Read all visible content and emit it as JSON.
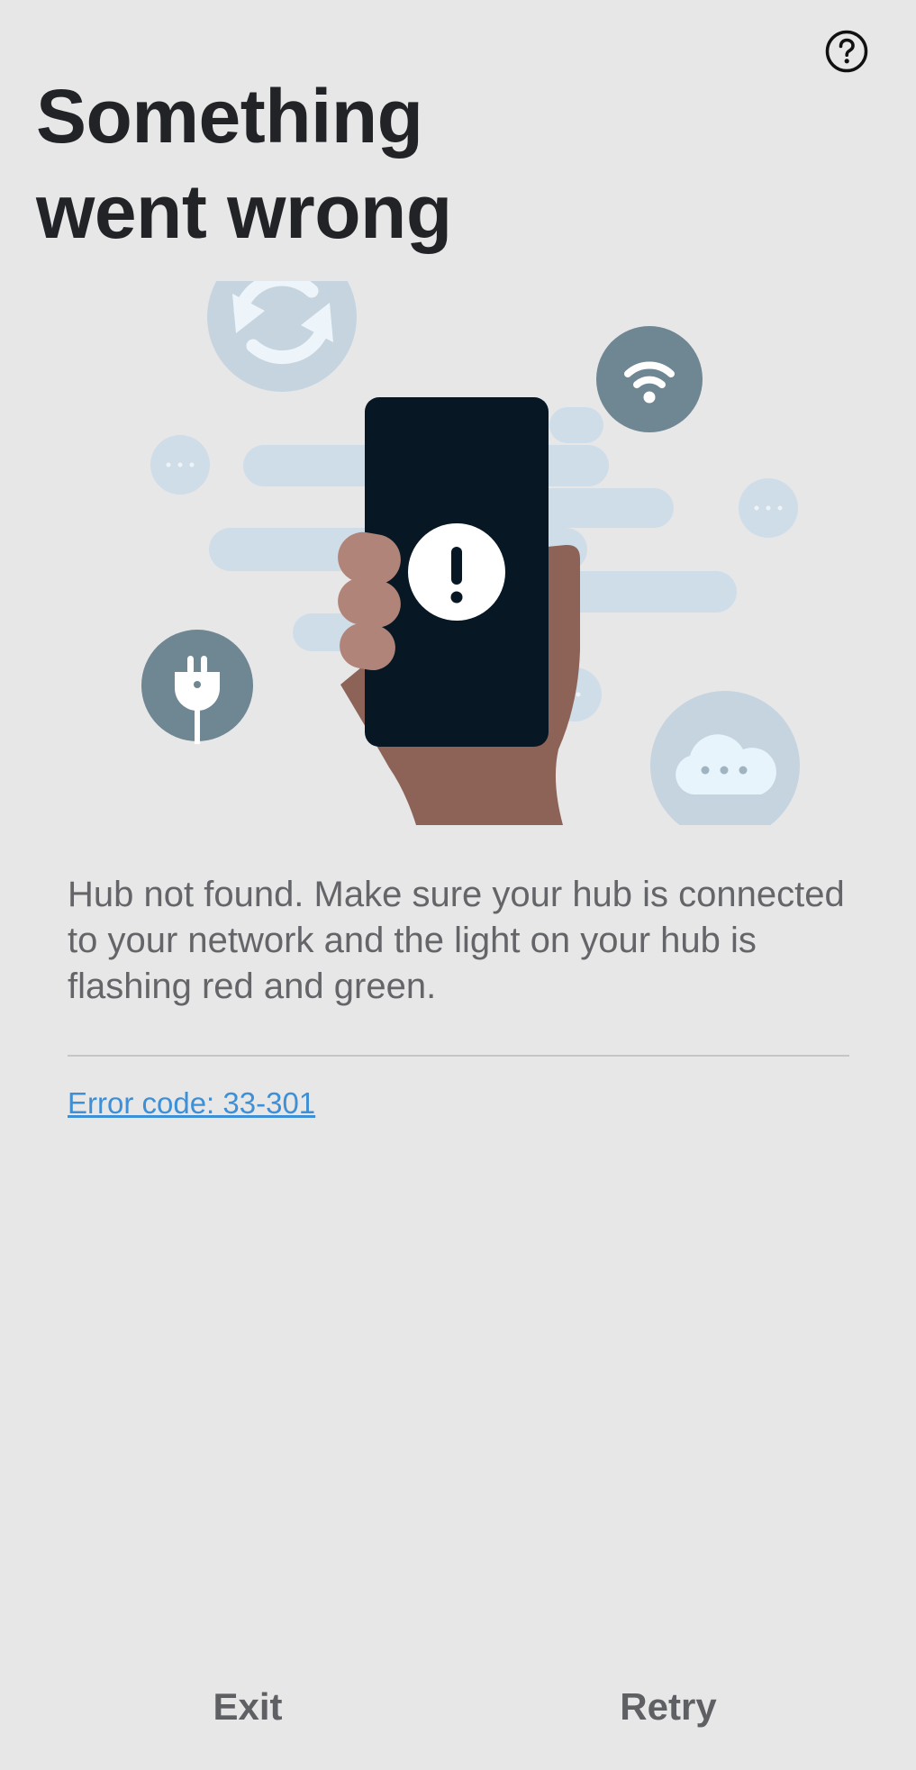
{
  "header": {
    "help_icon": "question-circle-icon",
    "title_line_1": "Something",
    "title_line_2": "went wrong"
  },
  "illustration": {
    "icons": [
      "sync-icon",
      "wifi-icon",
      "plug-icon",
      "cloud-icon",
      "alert-icon",
      "phone-icon",
      "hand-icon"
    ],
    "colors": {
      "phone": "#071824",
      "skin_dark": "#8d6358",
      "skin_light": "#b08478",
      "icon_circle_dark": "#6f8693",
      "icon_circle_light": "#c5d4df",
      "cloud_streaks": "#cfdde8"
    }
  },
  "content": {
    "message": "Hub not found. Make sure your hub is connected to your network and the light on your hub is flashing red and green.",
    "error_code_link": "Error code: 33-301",
    "link_color": "#3d8fd6"
  },
  "footer": {
    "exit_label": "Exit",
    "retry_label": "Retry"
  }
}
